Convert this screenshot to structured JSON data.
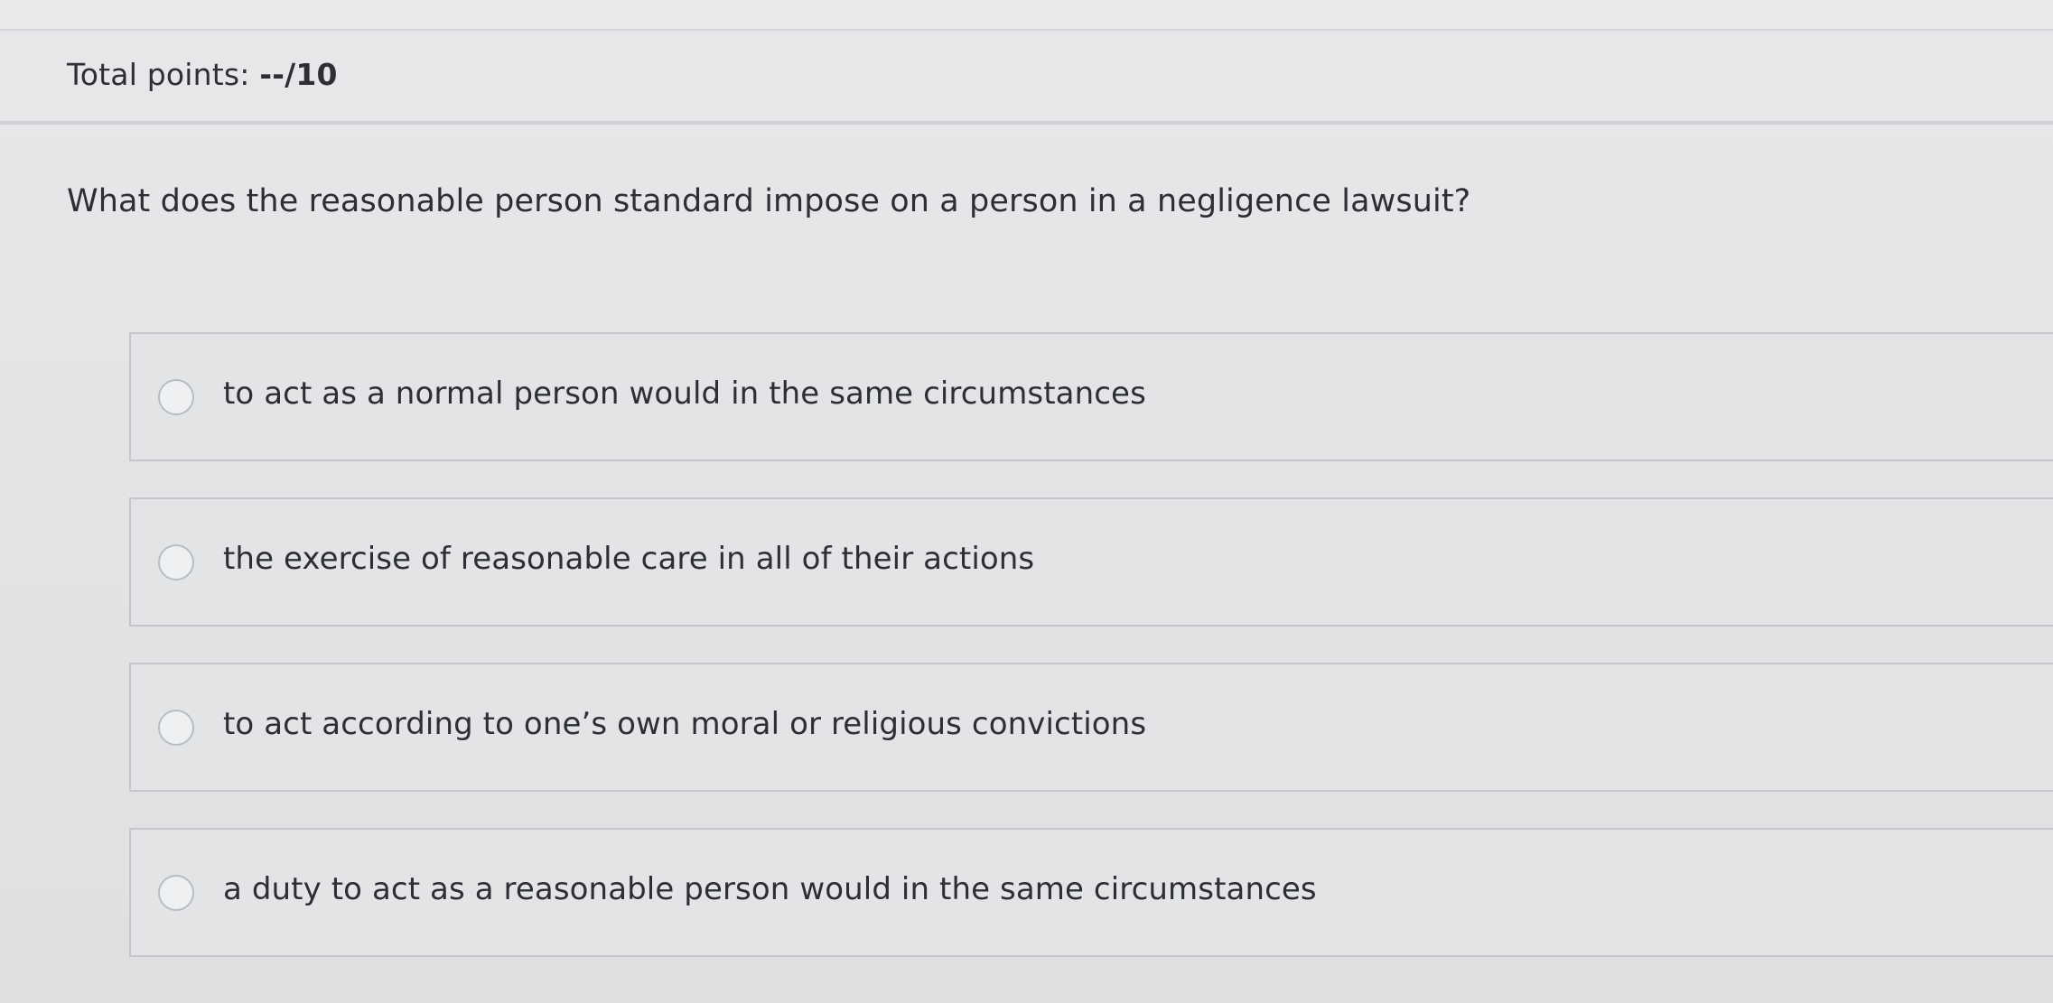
{
  "header": {
    "points_label": "Total points: ",
    "points_value": "--/10"
  },
  "question": {
    "text": "What does the reasonable person standard impose on a person in a negligence lawsuit?"
  },
  "options": [
    {
      "text": "to act as a normal person would in the same circumstances"
    },
    {
      "text": "the exercise of reasonable care in all of their actions"
    },
    {
      "text": "to act according to one’s own moral or religious convictions"
    },
    {
      "text": "a duty to act as a reasonable person would in the same circumstances"
    }
  ],
  "colors": {
    "background": "#e4e5e7",
    "text": "#2d2f33",
    "border": "#c4c6ca"
  }
}
